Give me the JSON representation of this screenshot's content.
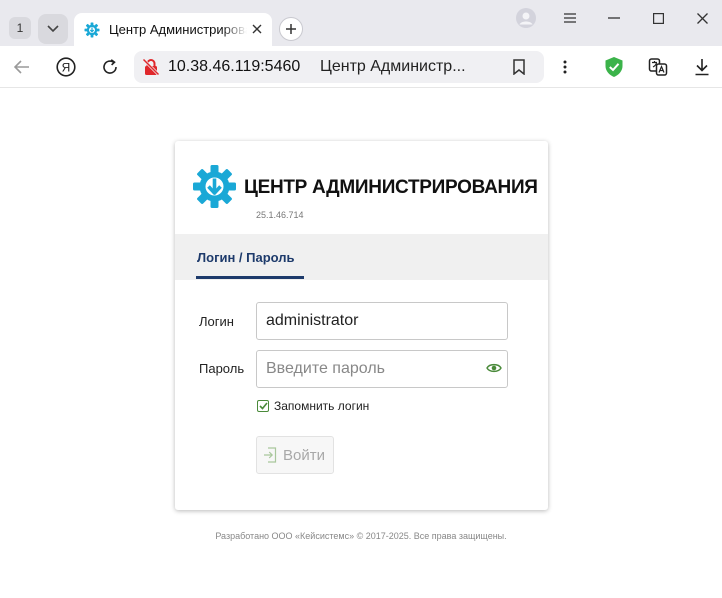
{
  "browser": {
    "tab_counter": "1",
    "tab_title": "Центр Администрирования",
    "address_host": "10.38.46.119:5460",
    "address_title": "Центр Администр..."
  },
  "icons": {
    "tab_list": "chevron-down-icon",
    "favicon": "gear-download-icon",
    "tab_close": "close-icon",
    "new_tab": "plus-icon",
    "profile": "avatar-icon",
    "menu": "hamburger-icon",
    "minimize": "minimize-icon",
    "maximize": "maximize-icon",
    "close": "close-icon",
    "back": "arrow-left-icon",
    "yandex": "yandex-icon",
    "reload": "reload-icon",
    "insecure": "insecure-lock-icon",
    "bookmark": "bookmark-icon",
    "more": "more-vertical-icon",
    "protect": "shield-check-icon",
    "translate": "translate-icon",
    "downloads": "download-icon",
    "eye": "eye-icon",
    "login": "login-icon"
  },
  "colors": {
    "brand_blue": "#1d3a6b",
    "logo_cyan": "#1aa8d6",
    "check_green": "#4a8a3a",
    "shield_green": "#3bb34a"
  },
  "app": {
    "title": "ЦЕНТР АДМИНИСТРИРОВАНИЯ",
    "version": "25.1.46.714",
    "tab_label": "Логин / Пароль",
    "login_label": "Логин",
    "login_value": "administrator",
    "password_label": "Пароль",
    "password_placeholder": "Введите пароль",
    "remember_label": "Запомнить логин",
    "remember_checked": true,
    "submit_label": "Войти",
    "footer": "Разработано ООО «Кейсистемс» © 2017-2025. Все права защищены."
  }
}
